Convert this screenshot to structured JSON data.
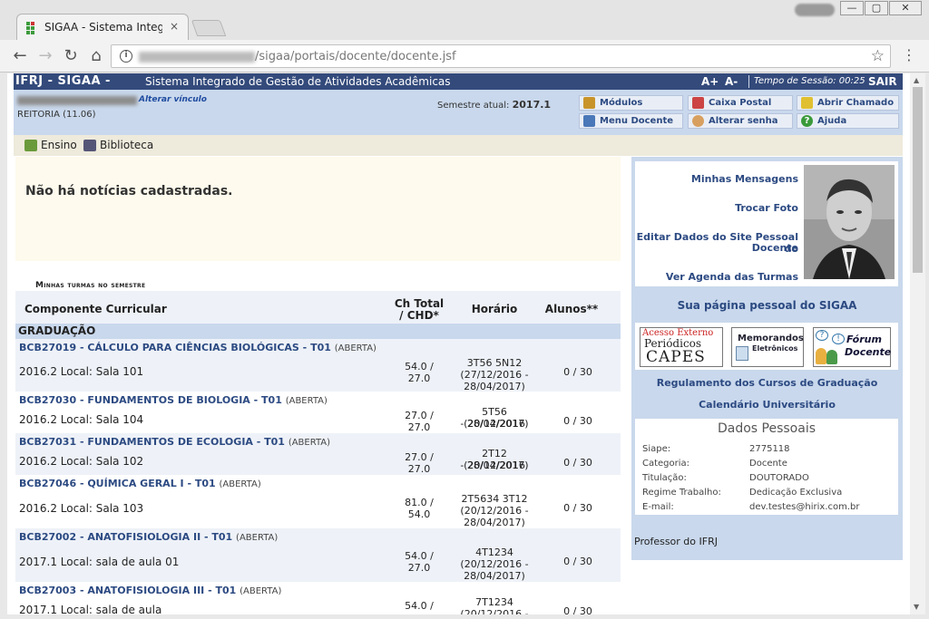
{
  "browser": {
    "tab_title": "SIGAA - Sistema Integrado",
    "url_path": "/sigaa/portais/docente/docente.jsf",
    "tab_close": "×",
    "nav_back": "←",
    "nav_forward": "→",
    "nav_reload": "↻",
    "nav_home": "⌂",
    "info": "i",
    "star": "☆",
    "menu": "⋮",
    "win_minimize": "—",
    "win_maximize": "▢",
    "win_close": "✕"
  },
  "header": {
    "system": "IFRJ - SIGAA -",
    "full_name": "Sistema Integrado de Gestão de Atividades Acadêmicas",
    "font_increase": "A+",
    "font_decrease": "A-",
    "session_label": "Tempo de Sessão: 00:25",
    "logout": "SAIR"
  },
  "user": {
    "alterar_vinculo": "Alterar vínculo",
    "unit": "REITORIA (11.06)",
    "semestre_label": "Semestre atual:",
    "semestre_value": "2017.1"
  },
  "quick_buttons": {
    "modulos": "Módulos",
    "caixa_postal": "Caixa Postal",
    "abrir_chamado": "Abrir Chamado",
    "menu_docente": "Menu Docente",
    "alterar_senha": "Alterar senha",
    "ajuda": "Ajuda"
  },
  "menu": {
    "ensino": "Ensino",
    "biblioteca": "Biblioteca"
  },
  "news": {
    "text": "Não há notícias cadastradas."
  },
  "turmas": {
    "section_label": "Minhas turmas no semestre",
    "headers": {
      "componente": "Componente Curricular",
      "ch_line1": "Ch Total",
      "ch_line2": "/ CHD*",
      "horario": "Horário",
      "alunos": "Alunos**"
    },
    "group": "GRADUAÇÃO",
    "rows": [
      {
        "name": "BCB27019 - CÁLCULO PARA CIÊNCIAS BIOLÓGICAS - T01",
        "status": "(ABERTA)",
        "local": "2016.2 Local: Sala 101",
        "ch1": "54.0 /",
        "ch2": "27.0",
        "h1": "3T56 5N12",
        "h2": "(27/12/2016 -",
        "h3": "28/04/2017)",
        "alunos": "0 / 30"
      },
      {
        "name": "BCB27030 - FUNDAMENTOS DE BIOLOGIA - T01",
        "status": "(ABERTA)",
        "local": "2016.2 Local: Sala 104",
        "ch1": "27.0 /",
        "ch2": "27.0",
        "h1": "5T56 (20/12/2016",
        "h2": "- 28/04/2017)",
        "h3": "",
        "alunos": "0 / 30"
      },
      {
        "name": "BCB27031 - FUNDAMENTOS DE ECOLOGIA - T01",
        "status": "(ABERTA)",
        "local": "2016.2 Local: Sala 102",
        "ch1": "27.0 /",
        "ch2": "27.0",
        "h1": "2T12 (20/12/2016",
        "h2": "- 28/04/2017)",
        "h3": "",
        "alunos": "0 / 30"
      },
      {
        "name": "BCB27046 - QUÍMICA GERAL I - T01",
        "status": "(ABERTA)",
        "local": "2016.2 Local: Sala 103",
        "ch1": "81.0 /",
        "ch2": "54.0",
        "h1": "2T5634 3T12",
        "h2": "(20/12/2016 -",
        "h3": "28/04/2017)",
        "alunos": "0 / 30"
      },
      {
        "name": "BCB27002 - ANATOFISIOLOGIA II - T01",
        "status": "(ABERTA)",
        "local": "2017.1 Local: sala de aula 01",
        "ch1": "54.0 /",
        "ch2": "27.0",
        "h1": "4T1234",
        "h2": "(20/12/2016 -",
        "h3": "28/04/2017)",
        "alunos": "0 / 30"
      },
      {
        "name": "BCB27003 - ANATOFISIOLOGIA III - T01",
        "status": "(ABERTA)",
        "local": "2017.1 Local: sala de aula",
        "ch1": "54.0 /",
        "ch2": "",
        "h1": "7T1234",
        "h2": "(20/12/2016 -",
        "h3": "",
        "alunos": "0 / 30"
      }
    ]
  },
  "sidebar": {
    "mensagens": "Minhas Mensagens",
    "trocar_foto": "Trocar Foto",
    "editar_line1": "Editar Dados do Site Pessoal do",
    "editar_line2": "Docente",
    "agenda": "Ver Agenda das Turmas",
    "pagina_pessoal": "Sua página pessoal do SIGAA",
    "logo_capes_line1": "Acesso Externo",
    "logo_capes_line2": "Periódicos",
    "logo_capes_line3": "CAPES",
    "logo_memo_line1": "Memorandos",
    "logo_memo_line2": "Eletrônicos",
    "logo_forum_line1": "Fórum",
    "logo_forum_line2": "Docente",
    "regulamento": "Regulamento dos Cursos de Graduação",
    "calendario": "Calendário Universitário",
    "dados_title": "Dados Pessoais",
    "dados": [
      {
        "label": "Siape:",
        "value": "2775118"
      },
      {
        "label": "Categoria:",
        "value": "Docente"
      },
      {
        "label": "Titulação:",
        "value": "DOUTORADO"
      },
      {
        "label": "Regime Trabalho:",
        "value": "Dedicação Exclusiva"
      },
      {
        "label": "E-mail:",
        "value": "dev.testes@hirix.com.br"
      }
    ],
    "professor": "Professor do IFRJ"
  }
}
